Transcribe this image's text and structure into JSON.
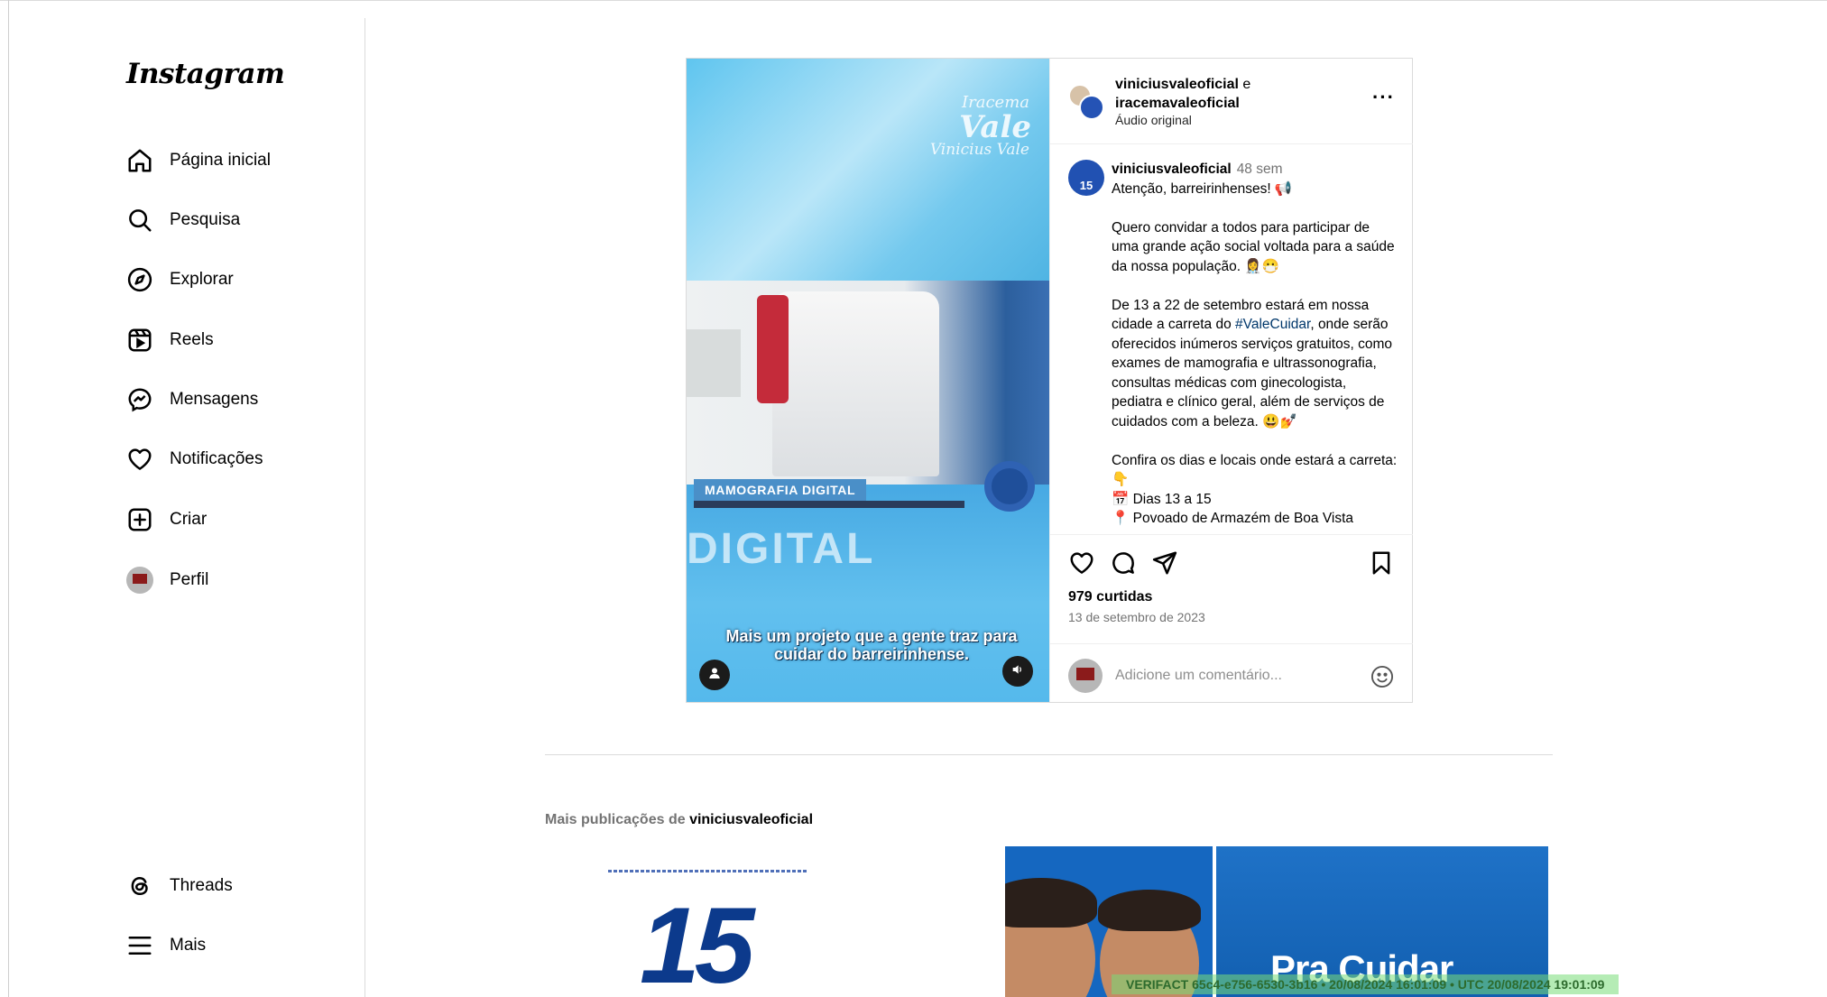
{
  "app": {
    "logo": "Instagram"
  },
  "sidebar": {
    "items": [
      {
        "label": "Página inicial",
        "icon": "home-icon"
      },
      {
        "label": "Pesquisa",
        "icon": "search-icon"
      },
      {
        "label": "Explorar",
        "icon": "compass-icon"
      },
      {
        "label": "Reels",
        "icon": "reels-icon"
      },
      {
        "label": "Mensagens",
        "icon": "messenger-icon"
      },
      {
        "label": "Notificações",
        "icon": "heart-icon"
      },
      {
        "label": "Criar",
        "icon": "plus-square-icon"
      },
      {
        "label": "Perfil",
        "icon": "avatar"
      }
    ],
    "bottom": [
      {
        "label": "Threads",
        "icon": "threads-icon"
      },
      {
        "label": "Mais",
        "icon": "menu-icon"
      }
    ]
  },
  "post": {
    "media": {
      "brand_top": "Iracema",
      "brand_main": "Vale",
      "brand_sub": "Vinicius Vale",
      "tag": "MAMOGRAFIA DIGITAL",
      "bg_word": "DIGITAL",
      "caption": "Mais um projeto que a gente traz para cuidar do barreirinhense."
    },
    "header": {
      "author1": "viniciusvaleoficial",
      "connector": "e",
      "author2": "iracemavaleoficial",
      "audio": "Áudio original"
    },
    "comment": {
      "user": "viniciusvaleoficial",
      "time": "48 sem",
      "p1": "Atenção, barreirinhenses! 📢",
      "p2": "Quero convidar a todos para participar de uma grande ação social voltada para a saúde da nossa população. 👩‍⚕️😷",
      "p3a": "De 13 a 22 de setembro estará em nossa cidade a carreta do ",
      "p3tag": "#ValeCuidar",
      "p3b": ", onde serão oferecidos inúmeros serviços gratuitos, como exames de mamografia e ultrassonografia, consultas médicas com ginecologista, pediatra e clínico geral, além de serviços de cuidados com a beleza. 😃💅",
      "p4": "Confira os dias e locais onde estará a carreta: 👇",
      "p5": "📅 Dias 13 a 15",
      "p6": "📍 Povoado de Armazém de Boa Vista"
    },
    "likes": "979 curtidas",
    "date": "13 de setembro de 2023",
    "comment_placeholder": "Adicione um comentário..."
  },
  "more_section": {
    "prefix": "Mais publicações de",
    "user": "viniciusvaleoficial",
    "thumb1_number": "15",
    "thumb3_title": "Pra Cuidar"
  },
  "watermark": "VERIFACT 65c4-e756-6530-3b16 • 20/08/2024 16:01:09 • UTC 20/08/2024 19:01:09"
}
